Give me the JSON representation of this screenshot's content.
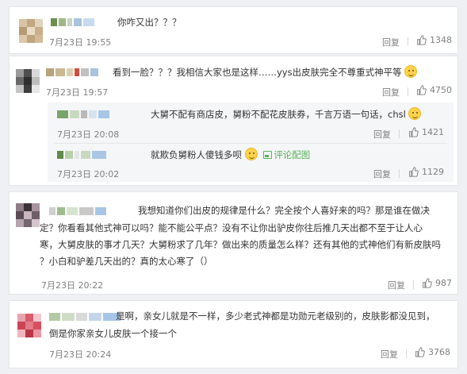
{
  "comments": [
    {
      "text": "你咋又出？？？",
      "time": "7月23日 19:55",
      "reply_label": "回复",
      "likes": "1348"
    },
    {
      "text": "看到一脸？？？我相信大家也是这样……yys出皮肤完全不尊重式神平等",
      "time": "7月23日 19:57",
      "reply_label": "回复",
      "likes": "4750",
      "sub_replies": [
        {
          "text": "大舅不配有商店皮，舅粉不配花皮肤券，千言万语一句话，chsl",
          "time": "7月23日 20:08",
          "reply_label": "回复",
          "likes": "1421"
        },
        {
          "text": "就欺负舅粉人傻钱多呗",
          "link_text": "评论配图",
          "time": "7月23日 20:02",
          "reply_label": "回复",
          "likes": "1129"
        }
      ]
    },
    {
      "text_lines": [
        "我想知道你们出皮的规律是什么？完全按个人喜好来的吗？那是谁在做决",
        "定？你看看其他式神可以吗？能不能公平点？没有不让你出驴皮你往后推几天出都不至于让人心",
        "寒，大舅皮肤的事才几天？大舅粉求了几年？做出来的质量怎么样？还有其他的式神他们有新皮肤吗",
        "？小白和驴差几天出的？真的太心寒了（）"
      ],
      "time": "7月23日 20:22",
      "reply_label": "回复",
      "likes": "987"
    },
    {
      "text_lines": [
        "是啊，亲女儿就是不一样，多少老式神都是功勋元老级别的，皮肤影都没见到，",
        "倒是你家亲女儿皮肤一个接一个"
      ],
      "time": "7月23日 20:24",
      "reply_label": "回复",
      "likes": "3768"
    }
  ],
  "colors": {
    "text": "#333333",
    "meta": "#808080",
    "link": "#5ab15a",
    "background": "#eef0f3",
    "sub_background": "#f5f6f8"
  },
  "icons": {
    "like": "thumbs-up-icon",
    "emoji": "smile-emoji-icon",
    "picture": "picture-icon"
  }
}
